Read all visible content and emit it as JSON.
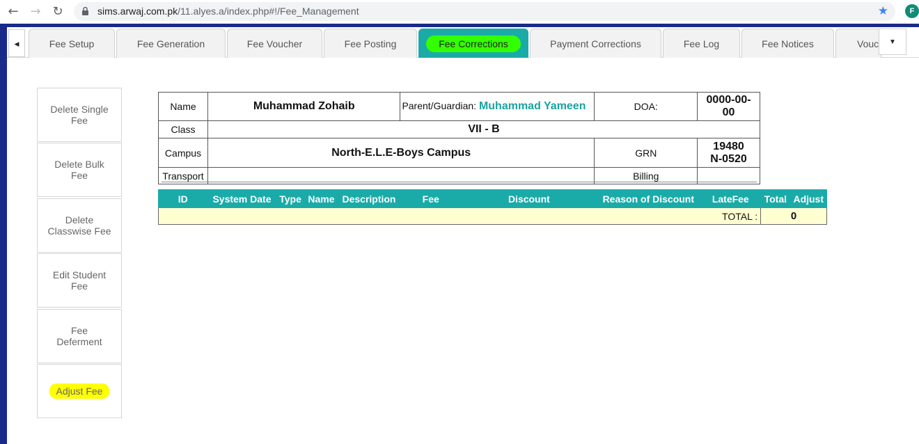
{
  "browser": {
    "url_host": "sims.arwaj.com.pk",
    "url_path": "/11.alyes.a/index.php#!/Fee_Management",
    "profile_initial": "F"
  },
  "tabs": [
    {
      "label": "Fee Setup"
    },
    {
      "label": "Fee Generation"
    },
    {
      "label": "Fee Voucher"
    },
    {
      "label": "Fee Posting"
    },
    {
      "label": "Fee Corrections"
    },
    {
      "label": "Payment Corrections"
    },
    {
      "label": "Fee Log"
    },
    {
      "label": "Fee Notices"
    },
    {
      "label": "Vouc"
    }
  ],
  "active_tab": "Fee Corrections",
  "sidebar": {
    "items": [
      {
        "label": "Delete Single Fee"
      },
      {
        "label": "Delete Bulk Fee"
      },
      {
        "label": "Delete Classwise Fee"
      },
      {
        "label": "Edit Student Fee"
      },
      {
        "label": "Fee Deferment"
      },
      {
        "label": "Adjust Fee"
      }
    ]
  },
  "student": {
    "name_label": "Name",
    "name": "Muhammad Zohaib",
    "guardian_label": "Parent/Guardian:",
    "guardian": "Muhammad Yameen",
    "doa_label": "DOA:",
    "doa": "0000-00-00",
    "class_label": "Class",
    "class": "VII - B",
    "campus_label": "Campus",
    "campus": "North-E.L.E-Boys Campus",
    "grn_label": "GRN",
    "grn_line1": "19480",
    "grn_line2": "N-0520",
    "transport_label": "Transport",
    "transport": "",
    "billing_label": "Billing",
    "billing": ""
  },
  "fee_table": {
    "headers": [
      "ID",
      "System Date",
      "Type",
      "Name",
      "Description",
      "Fee",
      "Discount",
      "Reason of Discount",
      "LateFee",
      "Total",
      "Adjust"
    ],
    "total_label": "TOTAL :",
    "total_value": "0"
  },
  "colors": {
    "accent": "#1aaba9",
    "frame": "#1a2a8a",
    "highlight_green": "#33ff00",
    "highlight_yellow": "#ffff00"
  }
}
